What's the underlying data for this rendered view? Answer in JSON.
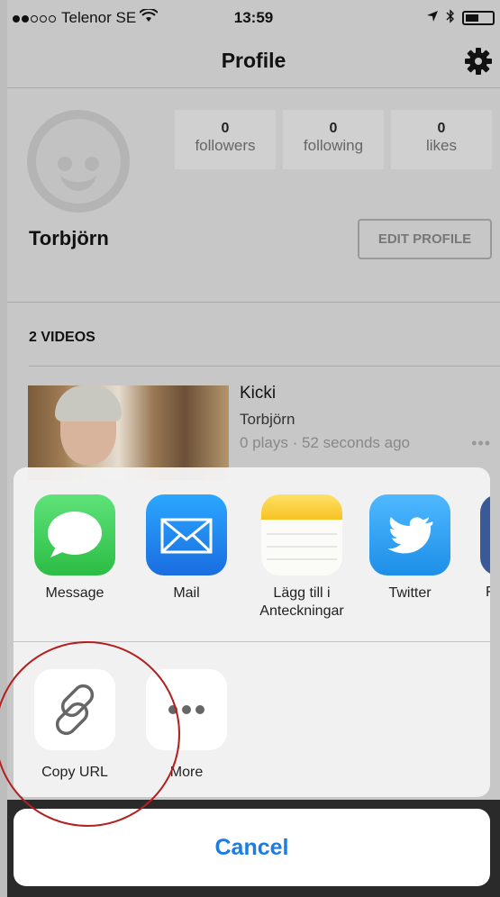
{
  "status": {
    "carrier": "Telenor SE",
    "time": "13:59"
  },
  "nav": {
    "title": "Profile"
  },
  "stats": [
    {
      "num": "0",
      "label": "followers"
    },
    {
      "num": "0",
      "label": "following"
    },
    {
      "num": "0",
      "label": "likes"
    }
  ],
  "profile": {
    "name": "Torbjörn",
    "edit_label": "EDIT PROFILE"
  },
  "videos": {
    "count_label": "2 VIDEOS"
  },
  "video": {
    "title": "Kicki",
    "author": "Torbjörn",
    "meta": "0 plays · 52 seconds ago",
    "more": "•••"
  },
  "share": {
    "apps": [
      {
        "label": "Message",
        "icon": "message-icon",
        "color": "#34c759"
      },
      {
        "label": "Mail",
        "icon": "mail-icon",
        "color": "#1a8cf0"
      },
      {
        "label": "Lägg till i Anteckningar",
        "icon": "notes-icon",
        "color": "#ffd33a"
      },
      {
        "label": "Twitter",
        "icon": "twitter-icon",
        "color": "#1da1f2"
      }
    ],
    "actions": [
      {
        "label": "Copy URL",
        "icon": "link-icon"
      },
      {
        "label": "More",
        "icon": "more-icon"
      }
    ],
    "cancel_label": "Cancel"
  },
  "colors": {
    "accent": "#1a7de2",
    "annotation": "#b32020"
  }
}
